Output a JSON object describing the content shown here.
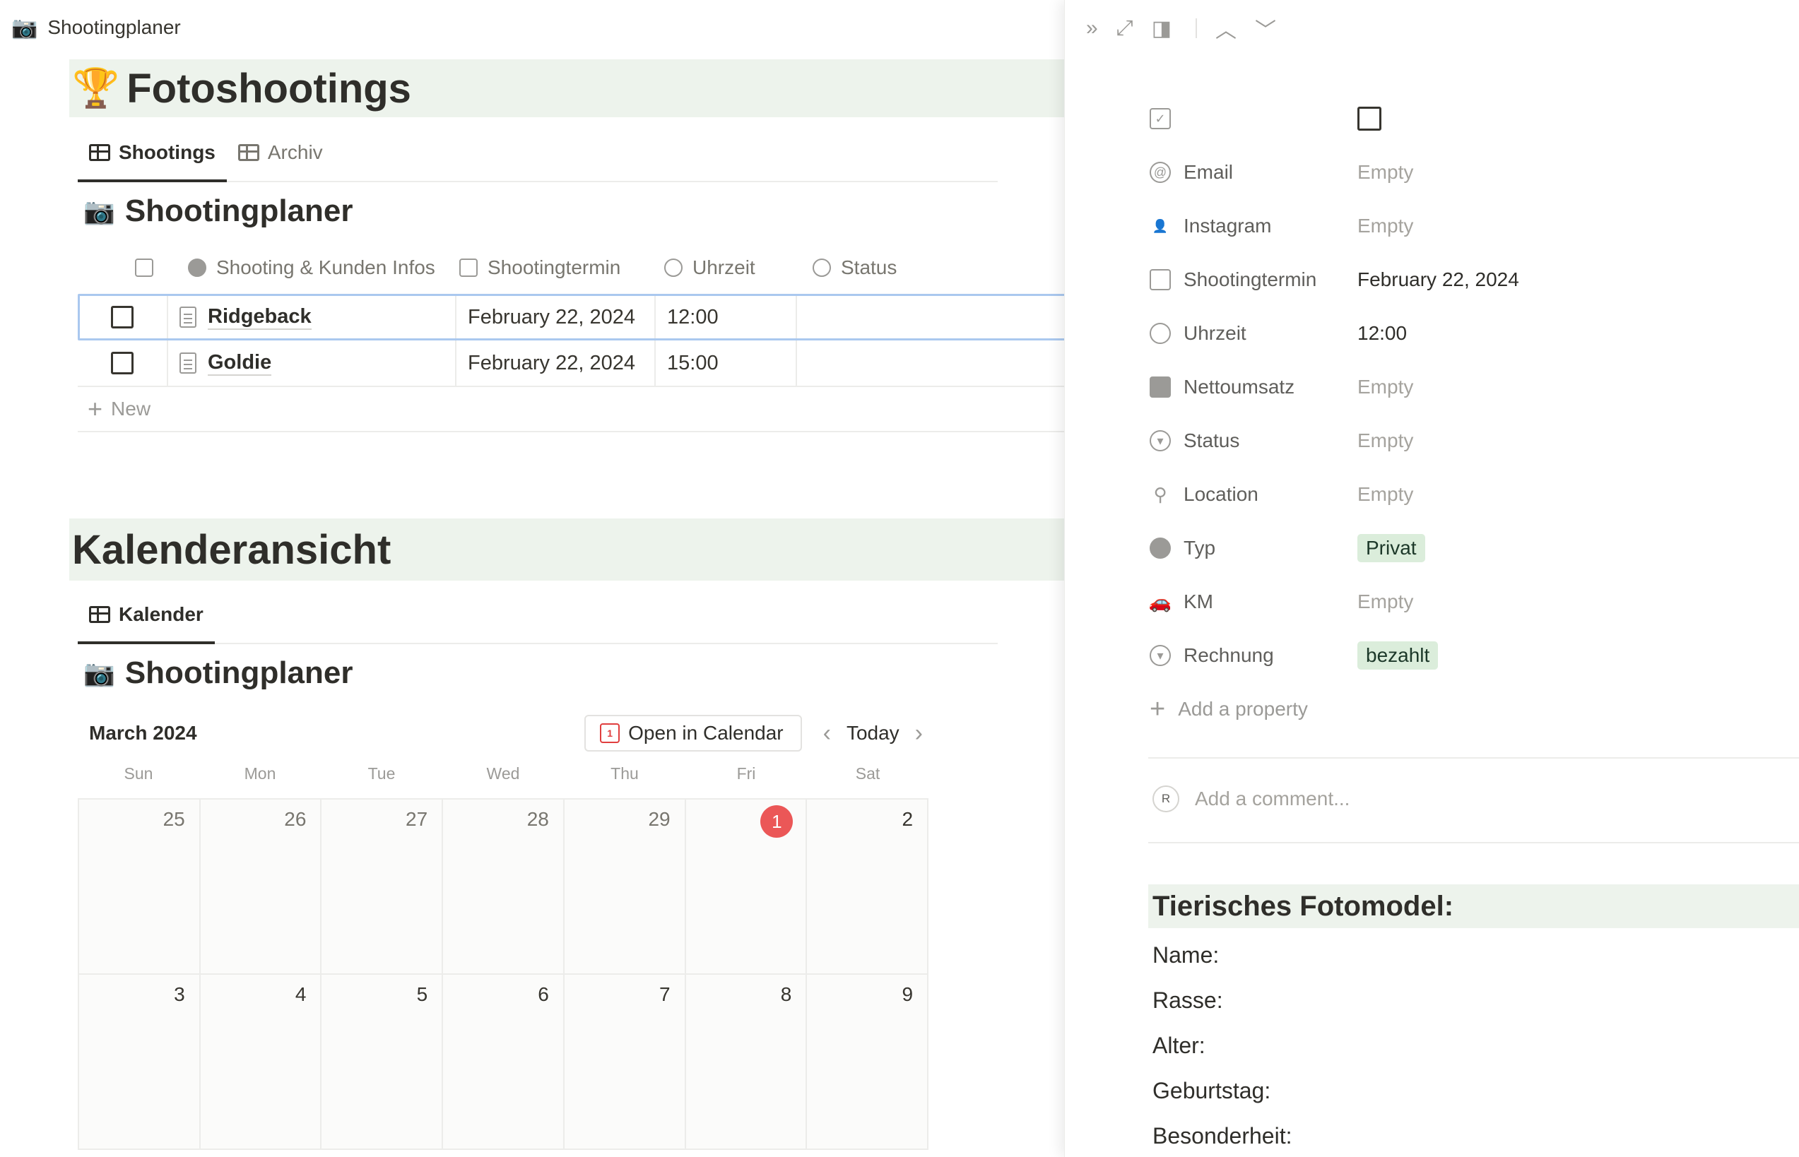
{
  "topbar": {
    "icon": "camera-icon",
    "title": "Shootingplaner"
  },
  "section1": {
    "emoji": "🏆",
    "title": "Fotoshootings",
    "tabs": [
      {
        "label": "Shootings",
        "active": true
      },
      {
        "label": "Archiv",
        "active": false
      }
    ],
    "db_title": "Shootingplaner",
    "table": {
      "headers": [
        "Shooting & Kunden Infos",
        "Shootingtermin",
        "Uhrzeit",
        "Status"
      ],
      "rows": [
        {
          "name": "Ridgeback",
          "date": "February 22, 2024",
          "time": "12:00",
          "status": ""
        },
        {
          "name": "Goldie",
          "date": "February 22, 2024",
          "time": "15:00",
          "status": ""
        }
      ],
      "new_label": "New"
    }
  },
  "section2": {
    "title": "Kalenderansicht",
    "tab": "Kalender",
    "db_title": "Shootingplaner",
    "calendar": {
      "month": "March 2024",
      "open_label": "Open in Calendar",
      "open_icon_text": "1",
      "today_label": "Today",
      "weekdays": [
        "Sun",
        "Mon",
        "Tue",
        "Wed",
        "Thu",
        "Fri",
        "Sat"
      ],
      "weeks": [
        [
          "25",
          "26",
          "27",
          "28",
          "29",
          "1",
          "2"
        ],
        [
          "3",
          "4",
          "5",
          "6",
          "7",
          "8",
          "9"
        ]
      ],
      "today_day": "1"
    }
  },
  "panel": {
    "properties": [
      {
        "icon": "checkbox-icon",
        "label": "",
        "value": ""
      },
      {
        "icon": "at-icon",
        "label": "Email",
        "value": "Empty"
      },
      {
        "icon": "person-icon",
        "label": "Instagram",
        "value": "Empty"
      },
      {
        "icon": "calendar-icon",
        "label": "Shootingtermin",
        "value": "February 22, 2024"
      },
      {
        "icon": "clock-icon",
        "label": "Uhrzeit",
        "value": "12:00"
      },
      {
        "icon": "money-icon",
        "label": "Nettoumsatz",
        "value": "Empty"
      },
      {
        "icon": "status-icon",
        "label": "Status",
        "value": "Empty"
      },
      {
        "icon": "location-icon",
        "label": "Location",
        "value": "Empty"
      },
      {
        "icon": "person-circle-icon",
        "label": "Typ",
        "value": "Privat",
        "tag": true
      },
      {
        "icon": "car-icon",
        "label": "KM",
        "value": "Empty"
      },
      {
        "icon": "status-icon",
        "label": "Rechnung",
        "value": "bezahlt",
        "tag": true
      }
    ],
    "add_property": "Add a property",
    "avatar_initial": "R",
    "comment_placeholder": "Add a comment...",
    "model_heading": "Tierisches Fotomodel:",
    "fields": [
      "Name:",
      "Rasse:",
      "Alter:",
      "Geburtstag:",
      "Besonderheit:"
    ]
  }
}
